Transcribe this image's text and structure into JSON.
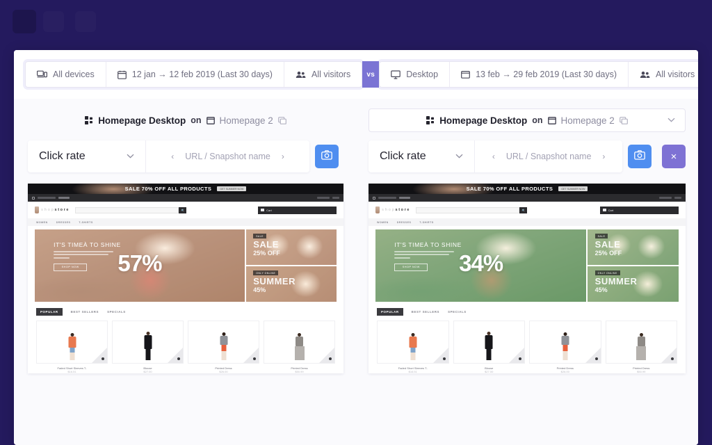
{
  "filter_bar": {
    "left": {
      "device": {
        "label": "All devices",
        "icon": "devices-icon"
      },
      "date": {
        "label": "12 jan → 12 feb 2019 (Last 30 days)",
        "icon": "calendar-icon"
      },
      "visitors": {
        "label": "All visitors",
        "icon": "users-icon"
      }
    },
    "vs_badge": "vs",
    "right": {
      "device": {
        "label": "Desktop",
        "icon": "monitor-icon"
      },
      "date": {
        "label": "13 feb → 29 feb 2019 (Last 30 days)",
        "icon": "calendar-icon"
      },
      "visitors": {
        "label": "All visitors",
        "icon": "users-icon"
      }
    }
  },
  "panels": [
    {
      "id": "left",
      "title": {
        "snapshot_icon": "grid-icon",
        "snapshot": "Homepage Desktop",
        "on": "on",
        "page_icon": "window-icon",
        "page": "Homepage 2",
        "copy_icon": "copy-icon"
      },
      "toolbar": {
        "metric": "Click rate",
        "metric_chevron": "chevron-down-icon",
        "prev": "‹",
        "url_label": "URL / Snapshot name",
        "next": "›",
        "camera": "camera-icon"
      },
      "snapshot": {
        "overlay_color": "#c98a5e",
        "percent": "57%",
        "banner": "SALE 70% OFF ALL PRODUCTS",
        "banner_chip": "GET SUMMER NOW",
        "logo": "shop store",
        "search_placeholder": "Search",
        "cart": "Cart",
        "cart_sub": "(empty)",
        "nav": [
          "WOMEN",
          "DRESSES",
          "T-SHIRTS"
        ],
        "hero_title": "IT'S TIMEÀ TO SHINE",
        "hero_button": "SHOP NOW",
        "promo_1_tag": "SALE",
        "promo_1_line1": "SALE",
        "promo_1_line2": "25% OFF",
        "promo_2_tag": "ONLY ONLINE",
        "promo_2_line1": "SUMMER",
        "promo_2_line2": "45%",
        "tabs": [
          "POPULAR",
          "BEST SELLERS",
          "SPECIALS"
        ],
        "active_tab": "POPULAR",
        "products": [
          {
            "name": "Faded Short Sleeves T-",
            "price": "$16.51"
          },
          {
            "name": "Blouse",
            "price": "$27.00"
          },
          {
            "name": "Printed Dress",
            "price": "$26.00"
          },
          {
            "name": "Printed Dress",
            "price": "$50.99"
          }
        ]
      }
    },
    {
      "id": "right",
      "title": {
        "snapshot_icon": "grid-icon",
        "snapshot": "Homepage Desktop",
        "on": "on",
        "page_icon": "window-icon",
        "page": "Homepage 2",
        "copy_icon": "copy-icon",
        "chevron": "chevron-down-icon"
      },
      "toolbar": {
        "metric": "Click rate",
        "metric_chevron": "chevron-down-icon",
        "prev": "‹",
        "url_label": "URL / Snapshot name",
        "next": "›",
        "camera": "camera-icon",
        "close": "×"
      },
      "snapshot": {
        "overlay_color": "#5faa5a",
        "percent": "34%",
        "banner": "SALE 70% OFF ALL PRODUCTS",
        "banner_chip": "GET SUMMER NOW",
        "logo": "shop store",
        "search_placeholder": "Search",
        "cart": "Cart",
        "cart_sub": "(empty)",
        "nav": [
          "WOMEN",
          "DRESSES",
          "T-SHIRTS"
        ],
        "hero_title": "IT'S TIMEÀ TO SHINE",
        "hero_button": "SHOP NOW",
        "promo_1_tag": "SALE",
        "promo_1_line1": "SALE",
        "promo_1_line2": "25% OFF",
        "promo_2_tag": "ONLY ONLINE",
        "promo_2_line1": "SUMMER",
        "promo_2_line2": "45%",
        "tabs": [
          "POPULAR",
          "BEST SELLERS",
          "SPECIALS"
        ],
        "active_tab": "POPULAR",
        "products": [
          {
            "name": "Faded Short Sleeves T-",
            "price": "$16.51"
          },
          {
            "name": "Blouse",
            "price": "$27.00"
          },
          {
            "name": "Printed Dress",
            "price": "$26.00"
          },
          {
            "name": "Printed Dress",
            "price": "$50.99"
          }
        ]
      }
    }
  ],
  "colors": {
    "background": "#241a5e",
    "accent_purple": "#7b74d4",
    "accent_blue": "#4f8ef0",
    "left_overlay": "#c98a5e",
    "right_overlay": "#5faa5a"
  }
}
